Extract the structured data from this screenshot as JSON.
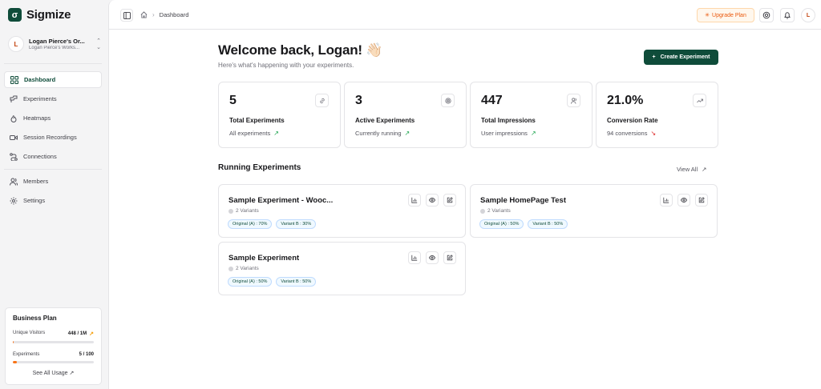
{
  "app": {
    "name": "Sigmize"
  },
  "org": {
    "initial": "L",
    "name": "Logan Pierce's Or...",
    "workspace": "Logan Pierce's Works..."
  },
  "nav": {
    "items": [
      {
        "label": "Dashboard",
        "icon": "grid-icon"
      },
      {
        "label": "Experiments",
        "icon": "experiments-icon"
      },
      {
        "label": "Heatmaps",
        "icon": "flame-icon"
      },
      {
        "label": "Session Recordings",
        "icon": "video-icon"
      },
      {
        "label": "Connections",
        "icon": "route-icon"
      },
      {
        "label": "Members",
        "icon": "users-icon"
      },
      {
        "label": "Settings",
        "icon": "gear-icon"
      }
    ],
    "active": "Dashboard"
  },
  "plan": {
    "title": "Business Plan",
    "visitors_label": "Unique Visitors",
    "visitors_value": "448 / 1M",
    "visitors_fraction": 0.000448,
    "experiments_label": "Experiments",
    "experiments_value": "5 / 100",
    "experiments_fraction": 0.05,
    "link": "See All Usage"
  },
  "breadcrumb": {
    "page": "Dashboard"
  },
  "topbar": {
    "upgrade_label": "Upgrade Plan",
    "avatar_initial": "L"
  },
  "welcome": {
    "title": "Welcome back, Logan! 👋🏻",
    "subtitle": "Here's what's happening with your experiments.",
    "create_label": "Create Experiment"
  },
  "stats": [
    {
      "value": "5",
      "label": "Total Experiments",
      "sub": "All experiments",
      "trend": "up",
      "icon": "link-icon"
    },
    {
      "value": "3",
      "label": "Active Experiments",
      "sub": "Currently running",
      "trend": "up",
      "icon": "target-icon"
    },
    {
      "value": "447",
      "label": "Total Impressions",
      "sub": "User impressions",
      "trend": "up",
      "icon": "users-icon"
    },
    {
      "value": "21.0%",
      "label": "Conversion Rate",
      "sub": "94 conversions",
      "trend": "down",
      "icon": "trending-icon"
    }
  ],
  "running": {
    "title": "Running Experiments",
    "view_all": "View All",
    "experiments": [
      {
        "title": "Sample Experiment - Wooc...",
        "variants": "2 Variants",
        "tags": [
          "Original (A) : 70%",
          "Variant B : 30%"
        ]
      },
      {
        "title": "Sample HomePage Test",
        "variants": "2 Variants",
        "tags": [
          "Original (A) : 50%",
          "Variant B : 50%"
        ]
      },
      {
        "title": "Sample Experiment",
        "variants": "2 Variants",
        "tags": [
          "Original (A) : 50%",
          "Variant B : 50%"
        ]
      }
    ]
  },
  "colors": {
    "brand": "#0f4c3a",
    "accent": "#ea580c",
    "trend_up": "#16a34a",
    "trend_down": "#dc2626"
  }
}
